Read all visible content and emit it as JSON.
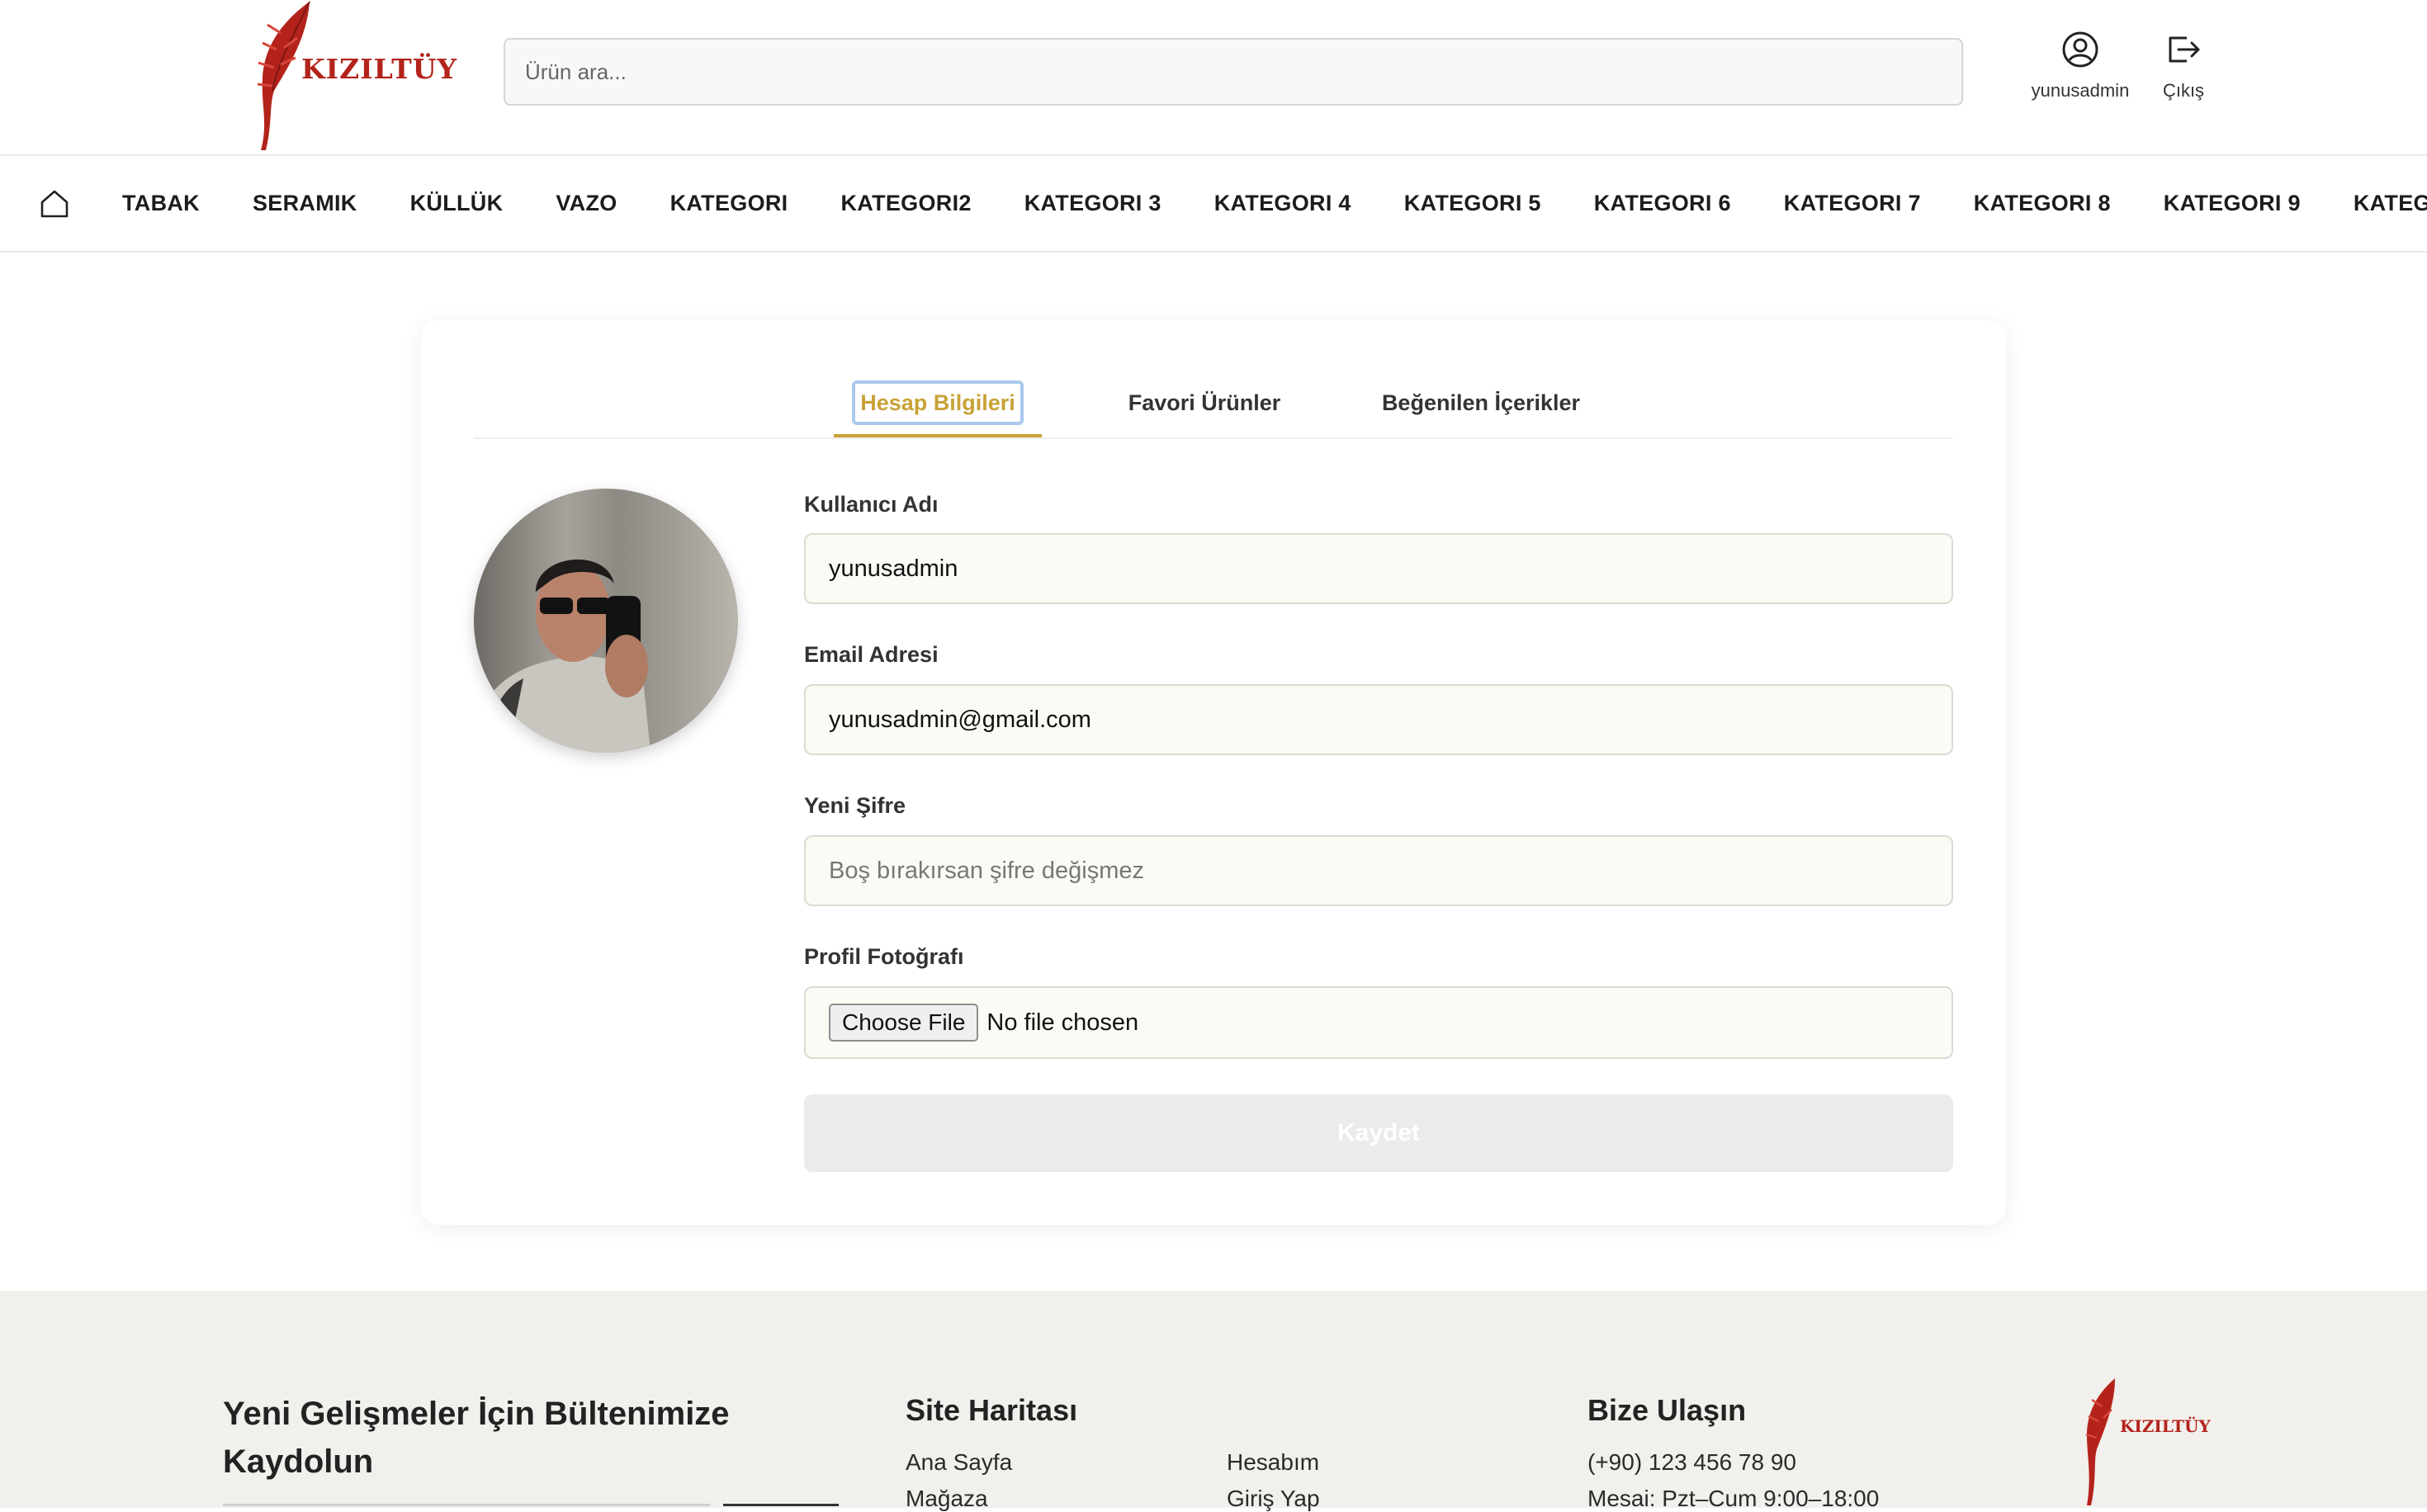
{
  "brand": {
    "name": "KIZILTÜY",
    "color": "#b3231b"
  },
  "header": {
    "search_placeholder": "Ürün ara...",
    "user_label": "yunusadmin",
    "logout_label": "Çıkış"
  },
  "nav": {
    "home_icon": "home-icon",
    "items": [
      "TABAK",
      "SERAMIK",
      "KÜLLÜK",
      "VAZO",
      "KATEGORI",
      "KATEGORI2",
      "KATEGORI 3",
      "KATEGORI 4",
      "KATEGORI 5",
      "KATEGORI 6",
      "KATEGORI 7",
      "KATEGORI 8",
      "KATEGORI 9",
      "KATEGORI"
    ]
  },
  "profile": {
    "tabs": [
      "Hesap Bilgileri",
      "Favori Ürünler",
      "Beğenilen İçerikler"
    ],
    "active_tab": "Hesap Bilgileri",
    "accent_color": "#c8a237",
    "fields": {
      "username_label": "Kullanıcı Adı",
      "username_value": "yunusadmin",
      "email_label": "Email Adresi",
      "email_value": "yunusadmin@gmail.com",
      "password_label": "Yeni Şifre",
      "password_placeholder": "Boş bırakırsan şifre değişmez",
      "photo_label": "Profil Fotoğrafı",
      "file_button": "Choose File",
      "file_status": "No file chosen"
    },
    "save_label": "Kaydet"
  },
  "footer": {
    "newsletter_title": "Yeni Gelişmeler İçin Bültenimize Kaydolun",
    "sitemap_title": "Site Haritası",
    "sitemap_links": [
      "Ana Sayfa",
      "Mağaza",
      "Hesabım",
      "Giriş Yap"
    ],
    "contact_title": "Bize Ulaşın",
    "phone": "(+90) 123 456 78 90",
    "hours": "Mesai: Pzt–Cum 9:00–18:00"
  }
}
